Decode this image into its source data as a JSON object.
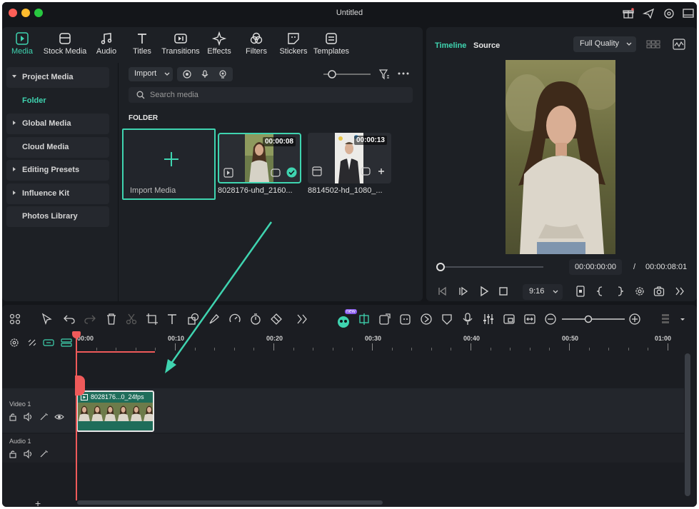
{
  "window": {
    "title": "Untitled"
  },
  "toolbar": {
    "tabs": [
      {
        "label": "Media",
        "icon": "media-icon",
        "active": true
      },
      {
        "label": "Stock Media",
        "icon": "stock-media-icon"
      },
      {
        "label": "Audio",
        "icon": "music-note-icon"
      },
      {
        "label": "Titles",
        "icon": "title-t-icon"
      },
      {
        "label": "Transitions",
        "icon": "transition-icon"
      },
      {
        "label": "Effects",
        "icon": "sparkle-icon"
      },
      {
        "label": "Filters",
        "icon": "filter-icon"
      },
      {
        "label": "Stickers",
        "icon": "sticker-icon"
      },
      {
        "label": "Templates",
        "icon": "template-icon"
      }
    ]
  },
  "sidebar": {
    "items": [
      {
        "label": "Project Media",
        "caret": "down"
      },
      {
        "label": "Folder",
        "active": true
      },
      {
        "label": "Global Media",
        "caret": "right"
      },
      {
        "label": "Cloud Media"
      },
      {
        "label": "Editing Presets",
        "caret": "right"
      },
      {
        "label": "Influence Kit",
        "caret": "right"
      },
      {
        "label": "Photos Library"
      }
    ]
  },
  "media": {
    "import_label": "Import",
    "search_placeholder": "Search media",
    "folder_heading": "FOLDER",
    "import_card_label": "Import Media",
    "clips": [
      {
        "name": "8028176-uhd_2160...",
        "duration": "00:00:08",
        "selected": true
      },
      {
        "name": "8814502-hd_1080_...",
        "duration": "00:00:13",
        "selected": false
      }
    ]
  },
  "preview": {
    "tabs": [
      {
        "label": "Timeline",
        "active": true
      },
      {
        "label": "Source"
      }
    ],
    "quality": "Full Quality",
    "current_time": "00:00:00:00",
    "separator": "/",
    "total_time": "00:00:08:01",
    "aspect_ratio": "9:16",
    "progress": 0
  },
  "timeline": {
    "ruler_labels": [
      "00:00",
      "00:10",
      "00:20",
      "00:30",
      "00:40",
      "00:50",
      "01:00"
    ],
    "tracks": [
      {
        "name": "Video 1"
      },
      {
        "name": "Audio 1"
      }
    ],
    "clip_title": "8028176...0_24fps",
    "badge": "new"
  },
  "colors": {
    "accent": "#3fd4b0",
    "playhead": "#ef5a5a"
  }
}
